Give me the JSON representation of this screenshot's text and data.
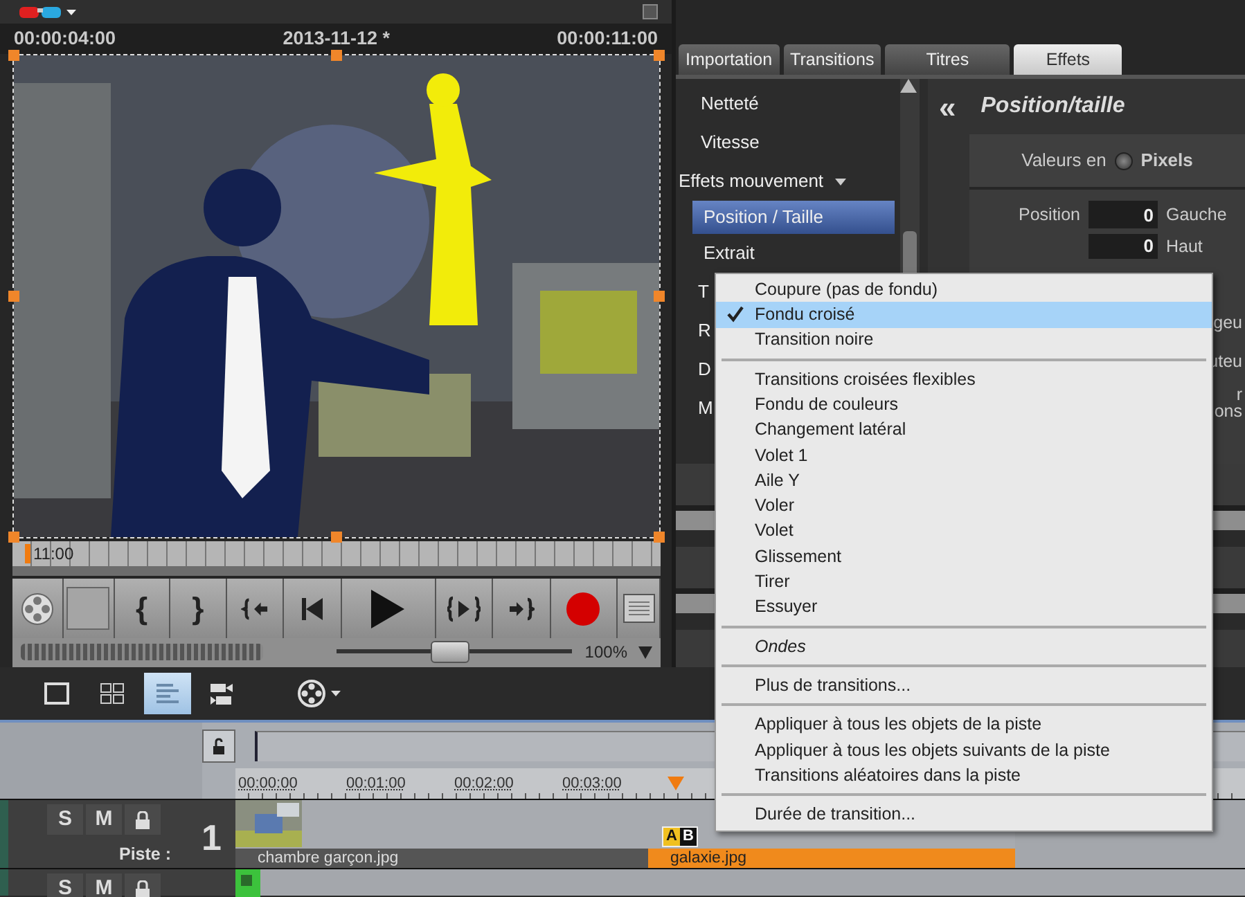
{
  "preview": {
    "timecode_in": "00:00:04:00",
    "title": "2013-11-12 *",
    "timecode_out": "00:00:11:00",
    "playhead_time": "11:00",
    "zoom_slider": {
      "level": 0.48
    },
    "zoom_value": "100%"
  },
  "transport": [
    {
      "kind": "reel"
    },
    {
      "kind": "blank"
    },
    {
      "kind": "text",
      "label": "{"
    },
    {
      "kind": "text",
      "label": "}"
    },
    {
      "kind": "jump-in"
    },
    {
      "kind": "to-start"
    },
    {
      "kind": "play"
    },
    {
      "kind": "play-range"
    },
    {
      "kind": "jump-out"
    },
    {
      "kind": "record"
    },
    {
      "kind": "menu"
    }
  ],
  "tabs": [
    {
      "label": "Importation",
      "selected": false
    },
    {
      "label": "Transitions",
      "selected": false
    },
    {
      "label": "Titres",
      "selected": false
    },
    {
      "label": "Effets",
      "selected": true
    }
  ],
  "effects_list": [
    {
      "kind": "item",
      "label": "Netteté",
      "selected": false
    },
    {
      "kind": "item",
      "label": "Vitesse",
      "selected": false
    },
    {
      "kind": "group",
      "label": "Effets mouvement",
      "expanded": true
    },
    {
      "kind": "subitem",
      "label": "Position / Taille",
      "selected": true
    },
    {
      "kind": "subitem",
      "label": "Extrait",
      "selected": false
    },
    {
      "kind": "subitem",
      "label": "T",
      "selected": false
    },
    {
      "kind": "subitem",
      "label": "R",
      "selected": false
    },
    {
      "kind": "subitem",
      "label": "D",
      "selected": false
    },
    {
      "kind": "subitem",
      "label": "M",
      "selected": false
    }
  ],
  "panel": {
    "back": "«",
    "title": "Position/taille",
    "units_label": "Valeurs en",
    "unit_option": {
      "label": "Pixels",
      "selected": false
    },
    "position_label": "Position",
    "fields": [
      {
        "value": "0",
        "label": "Gauche"
      },
      {
        "value": "0",
        "label": "Haut"
      }
    ],
    "cut_labels": [
      "geu",
      "uteu",
      "r",
      "ons"
    ]
  },
  "context_menu": [
    {
      "kind": "item",
      "label": "Coupure (pas de fondu)",
      "checked": false,
      "selected": false
    },
    {
      "kind": "item",
      "label": "Fondu croisé",
      "checked": true,
      "selected": true
    },
    {
      "kind": "item",
      "label": "Transition noire",
      "checked": false,
      "selected": false
    },
    {
      "kind": "separator"
    },
    {
      "kind": "item",
      "label": "Transitions croisées flexibles",
      "checked": false,
      "selected": false
    },
    {
      "kind": "item",
      "label": "Fondu de couleurs",
      "checked": false,
      "selected": false
    },
    {
      "kind": "item",
      "label": "Changement latéral",
      "checked": false,
      "selected": false
    },
    {
      "kind": "item",
      "label": "Volet 1",
      "checked": false,
      "selected": false
    },
    {
      "kind": "item",
      "label": "Aile Y",
      "checked": false,
      "selected": false
    },
    {
      "kind": "item",
      "label": "Voler",
      "checked": false,
      "selected": false
    },
    {
      "kind": "item",
      "label": "Volet",
      "checked": false,
      "selected": false
    },
    {
      "kind": "item",
      "label": "Glissement",
      "checked": false,
      "selected": false
    },
    {
      "kind": "item",
      "label": "Tirer",
      "checked": false,
      "selected": false
    },
    {
      "kind": "item",
      "label": "Essuyer",
      "checked": false,
      "selected": false
    },
    {
      "kind": "separator"
    },
    {
      "kind": "italic",
      "label": "Ondes",
      "checked": false,
      "selected": false
    },
    {
      "kind": "separator"
    },
    {
      "kind": "item",
      "label": "Plus de transitions...",
      "checked": false,
      "selected": false
    },
    {
      "kind": "separator"
    },
    {
      "kind": "item",
      "label": "Appliquer à tous les objets de la piste",
      "checked": false,
      "selected": false
    },
    {
      "kind": "item",
      "label": "Appliquer à tous les objets suivants de la piste",
      "checked": false,
      "selected": false
    },
    {
      "kind": "item",
      "label": "Transitions aléatoires dans la piste",
      "checked": false,
      "selected": false
    },
    {
      "kind": "separator"
    },
    {
      "kind": "item",
      "label": "Durée de transition...",
      "checked": false,
      "selected": false
    }
  ],
  "timeline": {
    "view_modes": [
      {
        "kind": "single",
        "selected": false
      },
      {
        "kind": "grid",
        "selected": false
      },
      {
        "kind": "timeline",
        "selected": true
      },
      {
        "kind": "camera",
        "selected": false
      }
    ],
    "ruler": [
      "00:00:00",
      "00:01:00",
      "00:02:00",
      "00:03:00"
    ],
    "tracks": [
      {
        "solo": "S",
        "mute": "M",
        "number": "1",
        "label": "Piste :",
        "transition": [
          "A",
          "B"
        ],
        "clips": [
          {
            "name": "chambre garçon.jpg",
            "selected": false
          },
          {
            "name": "galaxie.jpg",
            "selected": true
          }
        ]
      },
      {
        "solo": "S",
        "mute": "M"
      }
    ]
  }
}
